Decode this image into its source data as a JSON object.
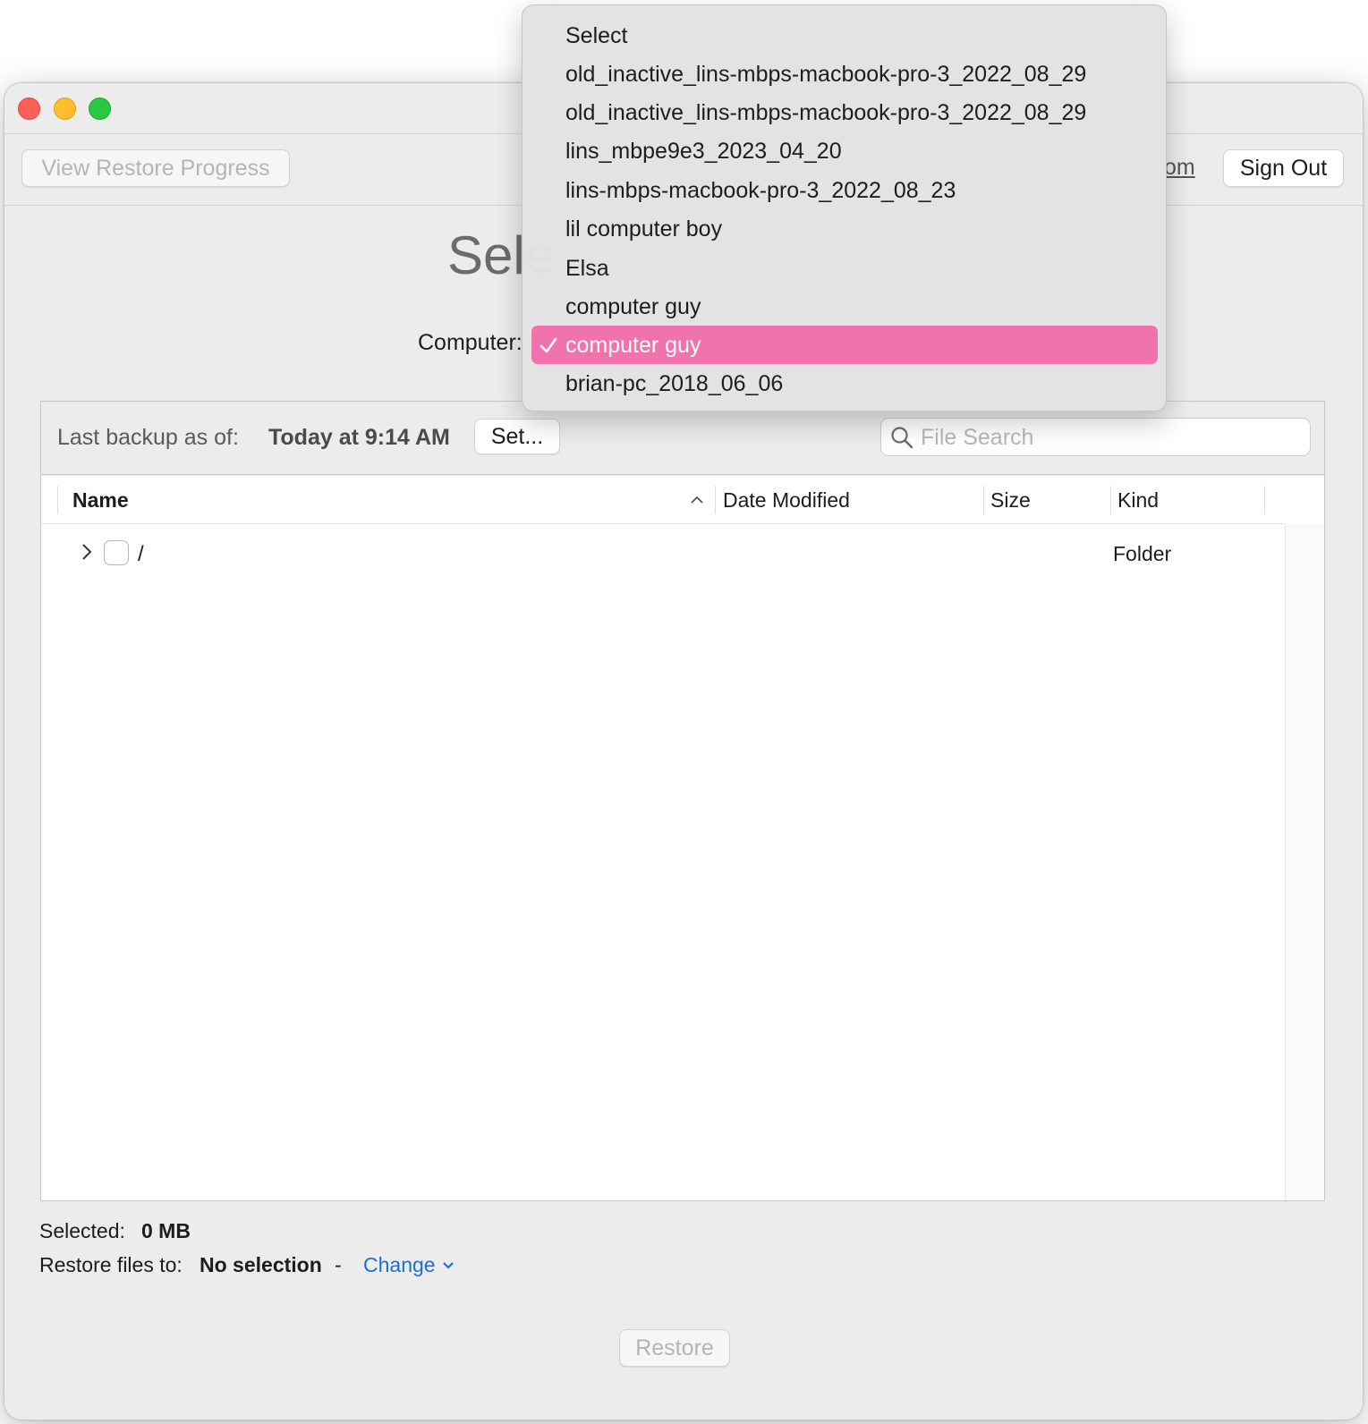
{
  "toolbar": {
    "view_restore_progress": "View Restore Progress",
    "account_link": "om",
    "sign_out": "Sign Out"
  },
  "heading": "Sele",
  "computer_label": "Computer:",
  "backup": {
    "label": "Last backup as of:",
    "value": "Today at 9:14 AM",
    "set_button": "Set..."
  },
  "search": {
    "placeholder": "File Search",
    "value": "",
    "icon": "magnifier-icon"
  },
  "table": {
    "columns": [
      "Name",
      "Date Modified",
      "Size",
      "Kind"
    ],
    "sort": "ascending",
    "rows": [
      {
        "name": "/",
        "date_modified": "",
        "size": "",
        "kind": "Folder",
        "checked": false,
        "expanded": false
      }
    ]
  },
  "footer": {
    "selected_label": "Selected:",
    "selected_value": "0 MB",
    "restore_to_label": "Restore files to:",
    "restore_to_value": "No selection",
    "dash": "-",
    "change_link": "Change",
    "restore_button": "Restore"
  },
  "dropdown": {
    "items": [
      "Select",
      "old_inactive_lins-mbps-macbook-pro-3_2022_08_29",
      "old_inactive_lins-mbps-macbook-pro-3_2022_08_29",
      "lins_mbpe9e3_2023_04_20",
      "lins-mbps-macbook-pro-3_2022_08_23",
      "lil computer boy",
      "Elsa",
      "computer guy",
      "computer guy",
      "brian-pc_2018_06_06"
    ],
    "selected_index": 8,
    "highlight_color": "#f173ad"
  },
  "colors": {
    "window_bg": "#ececec",
    "link_blue": "#1a6fd6",
    "traffic_red": "#ff5f57",
    "traffic_yellow": "#febc2e",
    "traffic_green": "#28c840"
  }
}
